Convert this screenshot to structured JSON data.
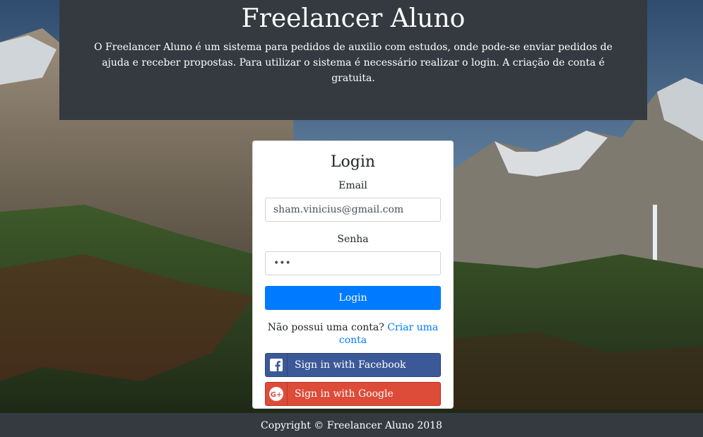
{
  "header": {
    "title": "Freelancer Aluno",
    "description": "O Freelancer Aluno é um sistema para pedidos de auxilio com estudos, onde pode-se enviar pedidos de ajuda e receber propostas. Para utilizar o sistema é necessário realizar o login. A criação de conta é gratuita."
  },
  "login": {
    "title": "Login",
    "email_label": "Email",
    "email_value": "sham.vinicius@gmail.com",
    "password_label": "Senha",
    "password_value": "•••",
    "submit_label": "Login",
    "signup_prompt": "Não possui uma conta?",
    "signup_link": "Criar uma conta",
    "facebook_label": "Sign in with Facebook",
    "google_label": "Sign in with Google"
  },
  "footer": {
    "copyright": "Copyright © Freelancer Aluno 2018"
  },
  "colors": {
    "header_bg": "#343a40",
    "primary": "#007bff",
    "facebook": "#3b5998",
    "google": "#dd4b39"
  }
}
